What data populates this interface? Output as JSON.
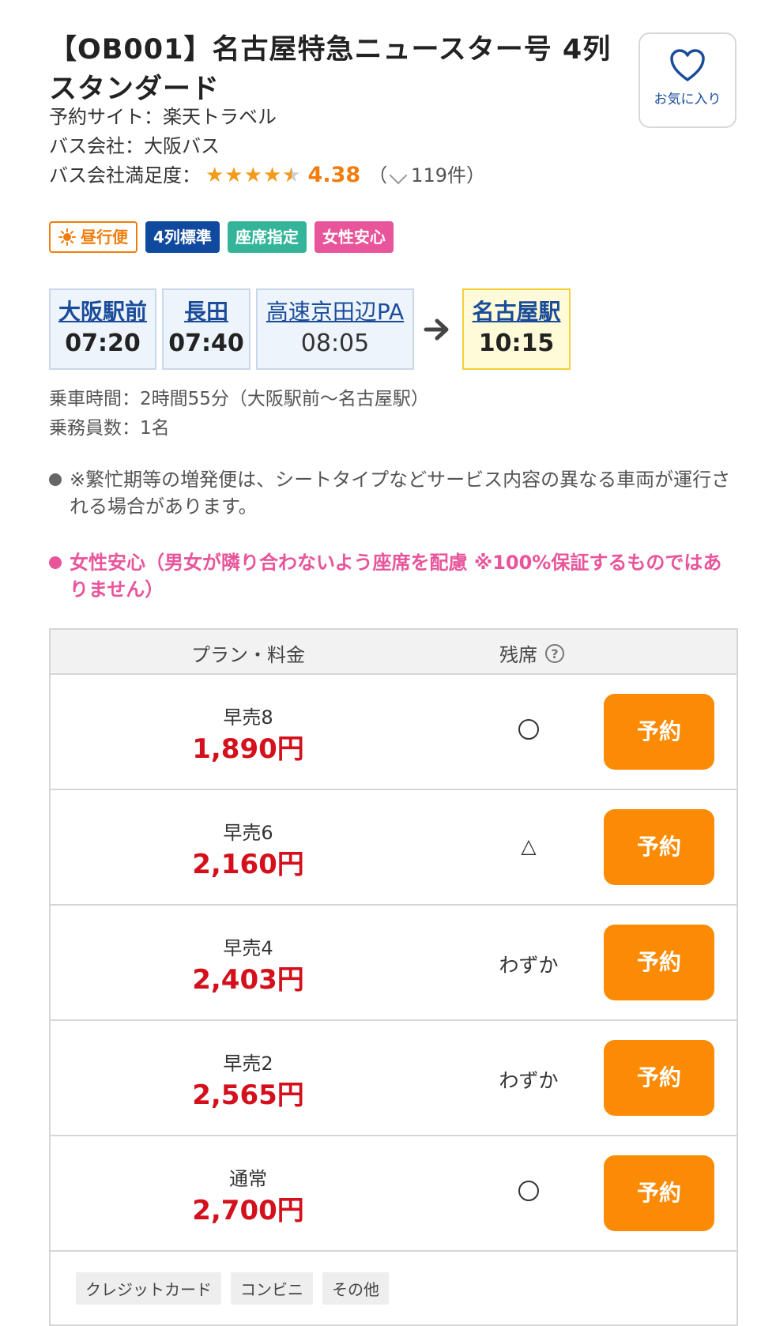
{
  "header": {
    "title": "【OB001】名古屋特急ニュースター号 4列スタンダード",
    "favorite_label": "お気に入り"
  },
  "meta": {
    "site": "予約サイト：楽天トラベル",
    "company": "バス会社：大阪バス",
    "satisfaction_label": "バス会社満足度：",
    "rating": 4.38,
    "rating_text": "4.38",
    "review_count_open": "（",
    "review_count": "119件）"
  },
  "tags": [
    {
      "label": "昼行便",
      "icon": "sun-icon"
    },
    {
      "label": "4列標準"
    },
    {
      "label": "座席指定"
    },
    {
      "label": "女性安心"
    }
  ],
  "route": {
    "stops": [
      {
        "name": "大阪駅前",
        "time": "07:20"
      },
      {
        "name": "長田",
        "time": "07:40"
      },
      {
        "name": "高速京田辺PA",
        "time": "08:05"
      }
    ],
    "destination": {
      "name": "名古屋駅",
      "time": "10:15"
    }
  },
  "info": {
    "duration": "乗車時間：2時間55分（大阪駅前〜名古屋駅）",
    "crew": "乗務員数：1名"
  },
  "notes": {
    "extra_bus": "※繁忙期等の増発便は、シートタイプなどサービス内容の異なる車両が運行される場合があります。",
    "ladies": "女性安心（男女が隣り合わないよう座席を配慮 ※100%保証するものではありません）"
  },
  "plans": {
    "header_plan": "プラン・料金",
    "header_seats": "残席",
    "help_icon": "question-icon",
    "reserve_label": "予約",
    "rows": [
      {
        "name": "早売8",
        "price": "1,890円",
        "availability": "○"
      },
      {
        "name": "早売6",
        "price": "2,160円",
        "availability": "△"
      },
      {
        "name": "早売4",
        "price": "2,403円",
        "availability": "わずか"
      },
      {
        "name": "早売2",
        "price": "2,565円",
        "availability": "わずか"
      },
      {
        "name": "通常",
        "price": "2,700円",
        "availability": "○"
      }
    ],
    "payments": [
      "クレジットカード",
      "コンビニ",
      "その他"
    ]
  },
  "colors": {
    "accent_orange": "#fb8b05",
    "price_red": "#d3101c",
    "link_blue": "#1a4c9a",
    "star": "#f29a1b",
    "pink": "#e8559b"
  }
}
